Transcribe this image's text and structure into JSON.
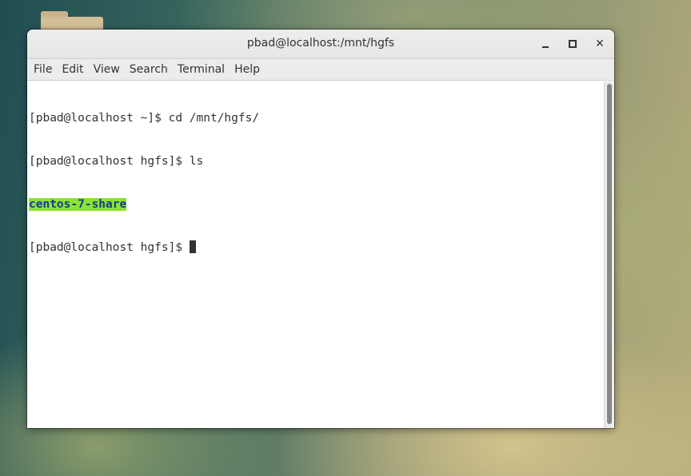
{
  "window": {
    "title": "pbad@localhost:/mnt/hgfs",
    "controls": {
      "minimize": "minimize-icon",
      "maximize": "maximize-icon",
      "close": "close-icon",
      "close_glyph": "✕"
    }
  },
  "menubar": {
    "items": [
      "File",
      "Edit",
      "View",
      "Search",
      "Terminal",
      "Help"
    ]
  },
  "terminal": {
    "lines": [
      "[pbad@localhost ~]$ cd /mnt/hgfs/",
      "[pbad@localhost hgfs]$ ls"
    ],
    "ls_output": "centos-7-share",
    "current_prompt": "[pbad@localhost hgfs]$ "
  },
  "colors": {
    "ls_highlight_bg": "#8ae234",
    "ls_highlight_fg": "#1a3a8a"
  },
  "desktop": {
    "icons": [
      "folder-icon"
    ]
  }
}
